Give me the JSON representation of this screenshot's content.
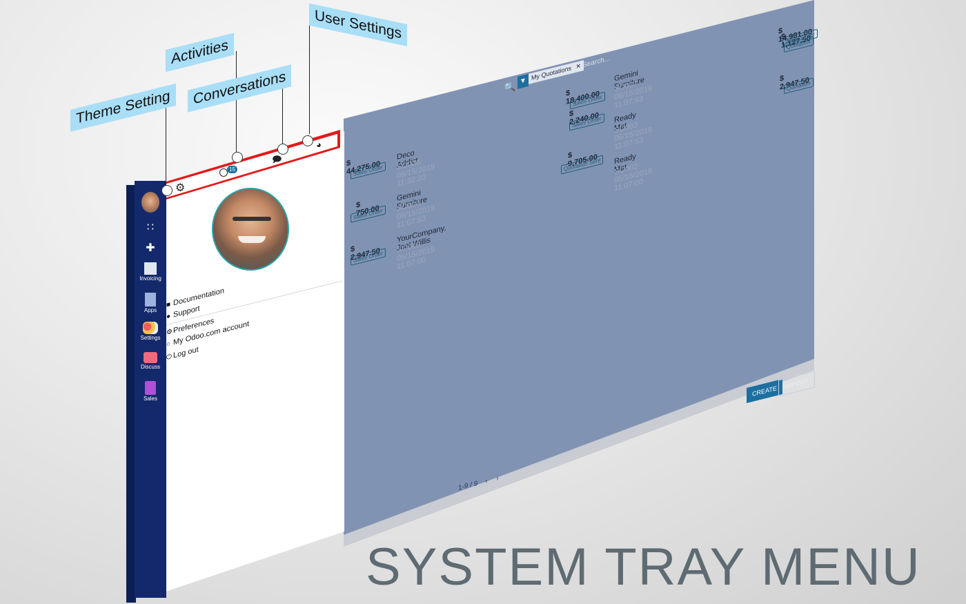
{
  "callouts": {
    "theme_setting": "Theme Setting",
    "activities": "Activities",
    "conversations": "Conversations",
    "user_settings": "User Settings"
  },
  "sidebar": {
    "items": [
      {
        "label": "",
        "icon": "avatar"
      },
      {
        "label": "",
        "icon": "apps-grid-icon"
      },
      {
        "label": "",
        "icon": "plus-icon"
      },
      {
        "label": "Invoicing",
        "icon": "invoicing-icon"
      },
      {
        "label": "Apps",
        "icon": "apps-icon"
      },
      {
        "label": "Settings",
        "icon": "settings-icon"
      },
      {
        "label": "Discuss",
        "icon": "discuss-icon"
      },
      {
        "label": "Sales",
        "icon": "sales-icon"
      }
    ]
  },
  "tray": {
    "activity_count": "15"
  },
  "user_menu": {
    "documentation": "Documentation",
    "support": "Support",
    "preferences": "Preferences",
    "odoo_account": "My Odoo.com account",
    "logout": "Log out"
  },
  "search": {
    "facet": "My Quotations",
    "placeholder": "Search..."
  },
  "cards": [
    {
      "amount": "$ 44,275.00",
      "badge": "Sales Order"
    },
    {
      "amount": "$ 750.00",
      "badge": "Sales Order"
    },
    {
      "amount": "$ 2,947.50",
      "badge": "Sales Order"
    },
    {
      "customer": "Deco Addict",
      "ref": "SO036 06/15/2019 11:32:20",
      "amount": "$ 2,240.00",
      "badge": "Sales Order"
    },
    {
      "customer": "Gemini Furniture",
      "ref": "SO004 06/15/2019 11:07:53",
      "amount": "$ 9,705.00",
      "badge": "Quotation Sent"
    },
    {
      "customer": "YourCompany, Joel Willis",
      "ref": "SO018 05/15/2019 11:07:00",
      "amount": "",
      "badge": ""
    },
    {
      "amount": "$ 18,400.00",
      "badge": "Sales Order"
    },
    {
      "customer": "Gemini Furniture",
      "ref": "SO007 06/15/2019 11:07:53",
      "amount": "$ 1,127.50",
      "badge": "Quotation"
    },
    {
      "customer": "Ready Mat",
      "ref": "SO003 06/15/2019 11:07:53",
      "amount": "$ 2,947.50",
      "badge": "Quotation"
    },
    {
      "customer": "Ready Mat",
      "ref": "SO002 05/15/2019 11:07:00",
      "amount": "",
      "badge": ""
    },
    {
      "amount": "$ 14,981.00",
      "badge": "Sales Order"
    }
  ],
  "actions": {
    "create": "CREATE",
    "import": "IMPORT"
  },
  "pager": {
    "text": "1-9 / 9"
  },
  "banner": "SYSTEM TRAY MENU",
  "colors": {
    "sidebar": "#13296b",
    "main": "#8193b3",
    "callout": "#a9def7",
    "highlight": "#e31a1a",
    "accent": "#1d6fa0"
  }
}
